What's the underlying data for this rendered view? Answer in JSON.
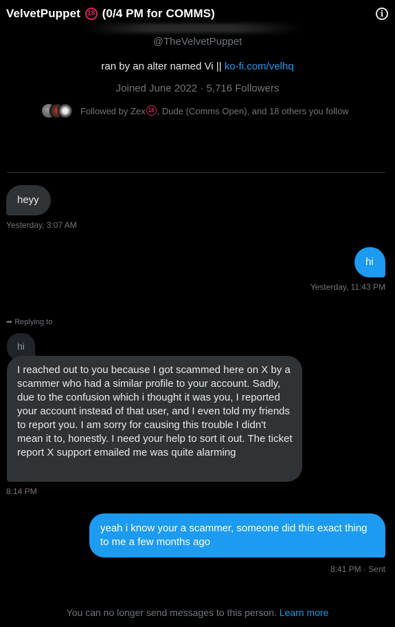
{
  "header": {
    "title_prefix": "VelvetPuppet",
    "badge": "18",
    "title_suffix": "(0/4 PM for COMMS)"
  },
  "profile": {
    "handle": "@TheVelvetPuppet",
    "bio_text": "ran by an alter named Vi || ",
    "bio_link": "ko-fi.com/velhq",
    "joined": "Joined June 2022",
    "separator": "·",
    "followers": "5,716 Followers",
    "followed_prefix": "Followed by Zex",
    "followed_badge": "18",
    "followed_suffix": ", Dude (Comms Open), and 18 others you follow"
  },
  "messages": [
    {
      "direction": "received",
      "text": "heyy",
      "time": "Yesterday, 3:07 AM"
    },
    {
      "direction": "sent",
      "text": "hi",
      "time": "Yesterday, 11:43 PM"
    },
    {
      "direction": "received",
      "replying_label": "Replying to",
      "reply_preview": "hi",
      "text": "I reached out to you because I got scammed here on X by a scammer who had a similar profile to your account. Sadly, due to the confusion which i thought it was you, I reported your account instead of that user, and I even told my friends to report you. I am sorry for causing this trouble I didn't mean it to, honestly. I need your help to sort it out. The ticket report X support emailed me was quite alarming",
      "time": "8:14 PM"
    },
    {
      "direction": "sent",
      "text": "yeah i know your a scammer, someone did this exact thing to me a few months ago",
      "time": "8:41 PM · Sent"
    }
  ],
  "footer": {
    "notice": "You can no longer send messages to this person. ",
    "link": "Learn more"
  },
  "colors": {
    "background": "#000000",
    "accent": "#1d9bf0",
    "received_bubble": "#2f3336",
    "muted_text": "#71767b",
    "badge": "#e0245e"
  },
  "icons": [
    "info-icon",
    "reply-arrow-icon",
    "age-18-badge-icon"
  ]
}
